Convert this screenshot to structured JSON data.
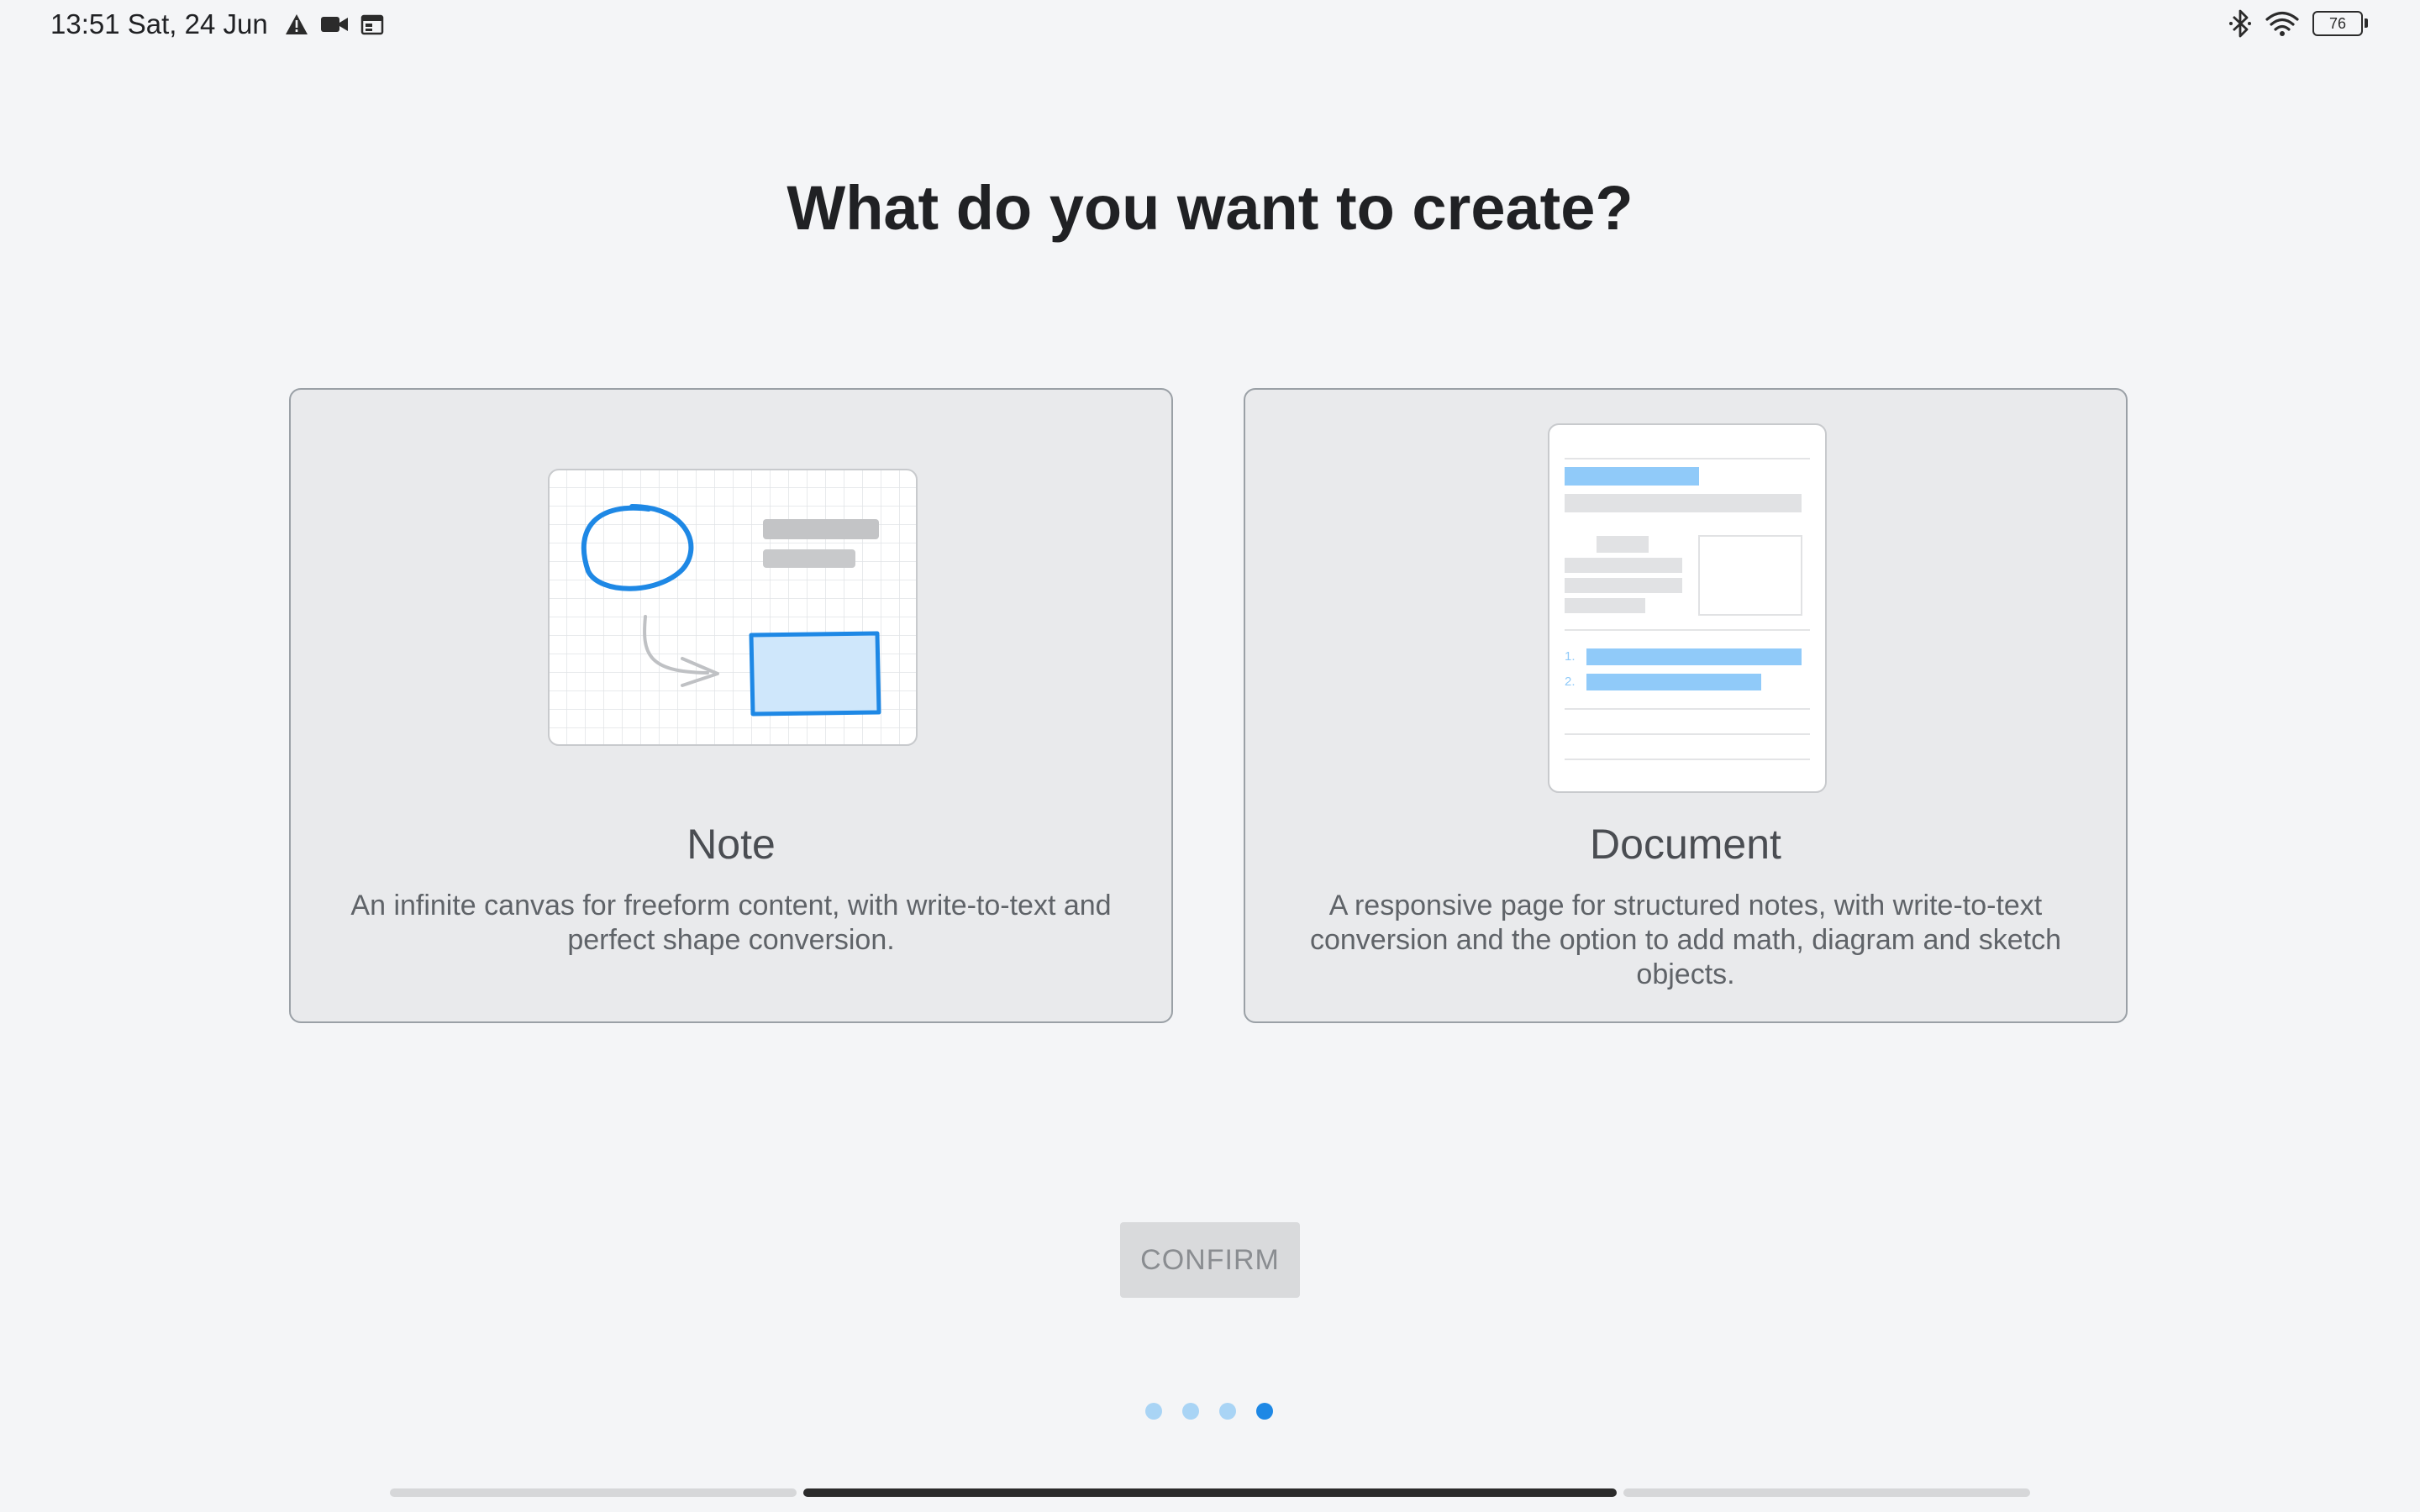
{
  "status_bar": {
    "time_date": "13:51 Sat, 24 Jun",
    "left_icons": [
      "warning-icon",
      "video-camera-icon",
      "calendar-icon"
    ],
    "right_icons": [
      "bluetooth-icon",
      "wifi-icon",
      "battery-icon"
    ],
    "battery_level": "76"
  },
  "title": "What do you want to create?",
  "cards": [
    {
      "id": "note",
      "title": "Note",
      "description": "An infinite canvas for freeform content, with write-to-text and perfect shape conversion."
    },
    {
      "id": "document",
      "title": "Document",
      "description": "A responsive page for structured notes, with write-to-text conversion and the option to add math, diagram and sketch objects.",
      "list_numbers": [
        "1.",
        "2."
      ]
    }
  ],
  "confirm_label": "CONFIRM",
  "pager": {
    "total": 4,
    "active": 4
  },
  "colors": {
    "background": "#f4f5f7",
    "card": "#e9eaec",
    "accent_blue": "#1e88e5",
    "light_blue": "#90caf9",
    "disabled_button": "#d9dadc"
  }
}
